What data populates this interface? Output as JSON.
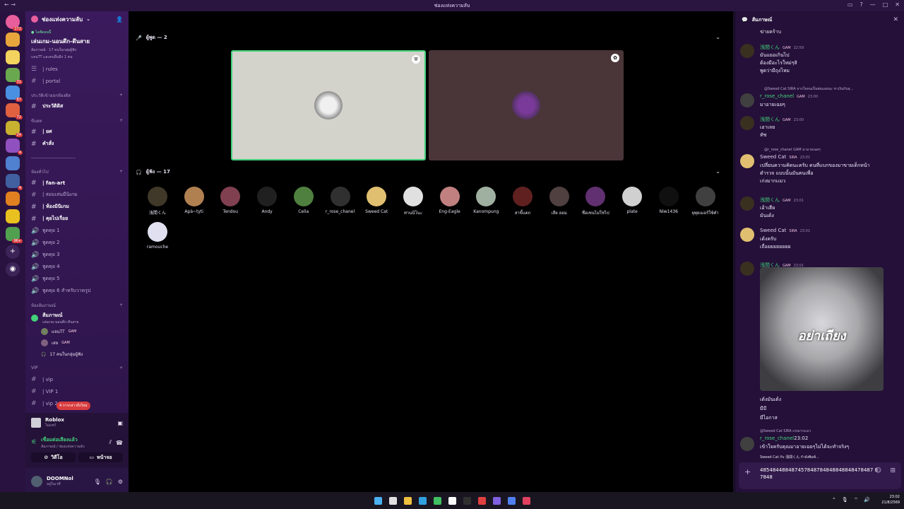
{
  "titlebar": {
    "title": "ช่องแห่งความลับ"
  },
  "guilds": [
    {
      "color": "#e85e9c",
      "badge": "172"
    },
    {
      "color": "#e8a53c",
      "badge": ""
    },
    {
      "color": "#f4d35e",
      "badge": ""
    },
    {
      "color": "#6aa84f",
      "badge": "31"
    },
    {
      "color": "#4a90e2",
      "badge": "67"
    },
    {
      "color": "#e06040",
      "badge": "72"
    },
    {
      "color": "#c8b030",
      "badge": "24"
    },
    {
      "color": "#9050c0",
      "badge": "4"
    },
    {
      "color": "#5080d0",
      "badge": ""
    },
    {
      "color": "#4060a0",
      "badge": "4"
    },
    {
      "color": "#e08020",
      "badge": ""
    },
    {
      "color": "#e8c020",
      "badge": ""
    },
    {
      "color": "#50a050",
      "badge": "96+"
    }
  ],
  "server": {
    "name": "ช่องแห่งความลับ"
  },
  "event": {
    "live": "● ไลฟ์ตอนนี้",
    "title": "เล่นเกม-นอนดึก-ดึนสาย",
    "meta": "ส้มภาษณ์ · 17 คนในกลุ่มผู้ฟัง",
    "sub": "แจนTT และคนอื่นอีก 1 คน"
  },
  "channels_top": [
    {
      "icon": "☰",
      "label": "| rules"
    },
    {
      "icon": "#",
      "label": "| portal"
    }
  ],
  "cat1": "ประวัติเข้าออกห้องดิส",
  "cat1_items": [
    {
      "label": "ประวัติดิส"
    }
  ],
  "cat2": "ขีบอท",
  "cat2_items": [
    {
      "label": "| ยศ"
    },
    {
      "label": "คำสั่ง"
    }
  ],
  "divider": "-----------------------------",
  "cat3": "ห้องทั่วไป",
  "cat3_items": [
    {
      "label": "| fan-art"
    },
    {
      "label": "| สอบเล่นมีนิเกม"
    },
    {
      "label": "| ห้องมินิเกม"
    },
    {
      "label": "| คุยไปเรื่อย"
    },
    {
      "label": "พูดคุย 1"
    },
    {
      "label": "พูดคุย 2"
    },
    {
      "label": "พูดคุย 3"
    },
    {
      "label": "พูดคุย 4"
    },
    {
      "label": "พูดคุย 5"
    },
    {
      "label": "พูดคุย 6 สำหรับวาดรูป"
    }
  ],
  "cat4": "ห้องส้มภาษณ์",
  "stage": {
    "name": "ส้มภาษณ์",
    "topic": "เล่นเกม-นอนดึก-ดึนสาย"
  },
  "stage_users": [
    {
      "name": "แจนTT",
      "tag": "GAM",
      "color": "#708060"
    },
    {
      "name": "เสย",
      "tag": "GAM",
      "color": "#806080"
    }
  ],
  "stage_listeners": "17 คนในกลุ่มผู้ฟัง",
  "cat5": "VIP",
  "cat5_items": [
    {
      "label": "| vip"
    },
    {
      "label": "| VIP 1"
    },
    {
      "label": "| vip 2"
    }
  ],
  "pill": "4 การกล่าวถึงใหม่",
  "activity": {
    "game": "Roblox",
    "status": "ไม่แชร์"
  },
  "voice": {
    "status": "เชื่อมต่อเสียงแล้ว",
    "location": "ส้มภาษณ์ / ช่องแห่งความลับ",
    "video_label": "วิดีโอ",
    "screen_label": "หน้าจอ"
  },
  "me": {
    "name": "DOOMNol",
    "status": "อยู่ในเวที"
  },
  "speakers_label": "ผู้พูด — 2",
  "listeners_label": "ผู้ฟัง — 17",
  "speakers": [
    {
      "bg": "#d3d2cb",
      "av": "#f0f0f0",
      "badge": "⛨"
    },
    {
      "bg": "#4a3538",
      "av": "#7a3a9a",
      "badge": "✿"
    }
  ],
  "listeners": [
    {
      "name": "浅間くん",
      "color": "#403828"
    },
    {
      "name": "Apà~tyti",
      "color": "#b08050"
    },
    {
      "name": "Tendou",
      "color": "#804050"
    },
    {
      "name": "Andy",
      "color": "#202020"
    },
    {
      "name": "Celia",
      "color": "#508040"
    },
    {
      "name": "r_rose_chanel",
      "color": "#303030"
    },
    {
      "name": "Sweed Cat",
      "color": "#e0c070"
    },
    {
      "name": "ท่านนีโนะ",
      "color": "#e0e0e0"
    },
    {
      "name": "Eng-Eagle",
      "color": "#c08080"
    },
    {
      "name": "Kanompung",
      "color": "#a0b0a0"
    },
    {
      "name": "สาขี้แตก",
      "color": "#602020"
    },
    {
      "name": "เสีย ออม",
      "color": "#504040"
    },
    {
      "name": "ชื่อเซนไม่ใช่ไป",
      "color": "#603070"
    },
    {
      "name": "plate",
      "color": "#d0d0d0"
    },
    {
      "name": "Niw1436",
      "color": "#101010"
    },
    {
      "name": "ยุพุยเมอร์ใช้คำ",
      "color": "#404040"
    },
    {
      "name": "ramouche",
      "color": "#e0e0f0"
    }
  ],
  "chat": {
    "title": "ส้มภาษณ์",
    "top_line": "ฆ่ายคร้าบ",
    "messages": [
      {
        "name": "浅間くん",
        "name_color": "#43d17a",
        "tag": "GAM",
        "time": "22:59",
        "lines": [
          "มันแยอเกินไป",
          "ต้องมีอะไรใหม่ๆสิ",
          "พูดว่ามีถุงไหม"
        ],
        "av": "#3a3020"
      },
      {
        "reply": "@Sweed Cat  SIRA  จากใจคนเป็นพ่อแอยนะ หาเงินกับสุ...",
        "name": "r_rose_chanel",
        "name_color": "#43d17a",
        "tag": "GAM",
        "time": "23:00",
        "lines": [
          "มาอายเฉยๆ"
        ],
        "av": "#404040"
      },
      {
        "name": "浅間くん",
        "name_color": "#43d17a",
        "tag": "GAM",
        "time": "23:00",
        "lines": [
          "เอาเลย",
          "ทัช"
        ],
        "av": "#3a3020"
      },
      {
        "reply": "@r_rose_chanel  GAM  มาอายเฉยๆ",
        "name": "Sweed Cat",
        "name_color": "#e0d0f0",
        "tag": "SIRA",
        "time": "23:01",
        "lines": [
          "เปลี่ยนความคิดนะครับ คนที่แบกของมาขายเด็กหน้า",
          "ตำรวจ แบบนั้นมันคนเพื่อ",
          "เก่งมากเเมว"
        ],
        "av": "#e0c070"
      },
      {
        "name": "浅間くん",
        "name_color": "#43d17a",
        "tag": "GAM",
        "time": "23:01",
        "lines": [
          "เอ้าเฮีย",
          "มันเด้ง"
        ],
        "av": "#3a3020"
      },
      {
        "name": "Sweed Cat",
        "name_color": "#e0d0f0",
        "tag": "SIRA",
        "time": "23:01",
        "lines": [
          "เด้งครับ",
          "เถื่อยยยยยยยย"
        ],
        "av": "#e0c070"
      },
      {
        "name": "浅間くん",
        "name_color": "#43d17a",
        "tag": "GAM",
        "time": "23:01",
        "lines": [],
        "av": "#3a3020"
      }
    ],
    "meme_caption": "อย่าเถียง",
    "after_meme": [
      "เด้งมันเด้ง",
      "มีมี",
      "มีไอกาส"
    ],
    "last_reply": "@Sweed Cat  SIRA  เก่งมากเเมว",
    "last": {
      "name": "r_rose_chanel",
      "time": "23:02",
      "line": "เข้าใจครับคุณมาอายเฉยๆไม่ได้จะทำจริงๆ"
    },
    "typing": "Sweed Cat กับ 浅間くん กำลังพิมพ์...",
    "input_value": "485484488487457848784848848848478487 87848"
  },
  "tray": {
    "time": "23:02",
    "date": "21/8/2569"
  },
  "taskbar_apps": [
    "#4ab0f0",
    "#e0e0e0",
    "#f0c040",
    "#30a0e0",
    "#40c060",
    "#ffffff",
    "#303030",
    "#e04040",
    "#8060e0",
    "#5080f0",
    "#e04060"
  ]
}
